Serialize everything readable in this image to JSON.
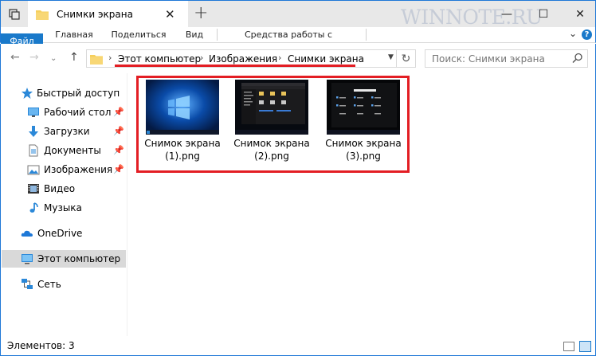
{
  "window": {
    "tab_title": "Снимки экрана",
    "watermark": "WINNOTE.RU"
  },
  "ribbon": {
    "tabs": [
      "Файл",
      "Главная",
      "Поделиться",
      "Вид",
      "Средства работы с рисунками"
    ]
  },
  "address": {
    "crumbs": [
      "Этот компьютер",
      "Изображения",
      "Снимки экрана"
    ]
  },
  "search": {
    "placeholder": "Поиск: Снимки экрана"
  },
  "sidebar": {
    "items": [
      {
        "label": "Быстрый доступ",
        "icon": "star-icon"
      },
      {
        "label": "Рабочий стол",
        "icon": "desktop-icon",
        "pinned": true
      },
      {
        "label": "Загрузки",
        "icon": "downloads-icon",
        "pinned": true
      },
      {
        "label": "Документы",
        "icon": "documents-icon",
        "pinned": true
      },
      {
        "label": "Изображения",
        "icon": "pictures-icon",
        "pinned": true
      },
      {
        "label": "Видео",
        "icon": "video-icon"
      },
      {
        "label": "Музыка",
        "icon": "music-icon"
      },
      {
        "label": "OneDrive",
        "icon": "onedrive-icon"
      },
      {
        "label": "Этот компьютер",
        "icon": "computer-icon",
        "selected": true
      },
      {
        "label": "Сеть",
        "icon": "network-icon"
      }
    ]
  },
  "files": [
    {
      "line1": "Снимок экрана",
      "line2": "(1).png"
    },
    {
      "line1": "Снимок экрана",
      "line2": "(2).png"
    },
    {
      "line1": "Снимок экрана",
      "line2": "(3).png"
    }
  ],
  "status": {
    "count": "Элементов: 3"
  },
  "colors": {
    "accent": "#1979ca",
    "highlight": "#e31e24"
  }
}
